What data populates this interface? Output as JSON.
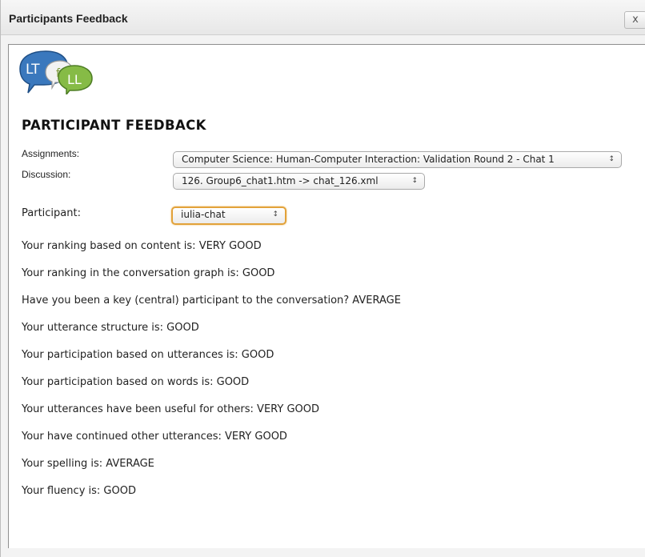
{
  "window": {
    "title": "Participants Feedback",
    "close_label": "x"
  },
  "logo": {
    "letters": [
      "LT",
      "f",
      "LL"
    ],
    "colors": [
      "#2f6fb1",
      "#8fbf4a",
      "#6fa84c"
    ]
  },
  "page": {
    "heading": "PARTICIPANT FEEDBACK"
  },
  "form": {
    "assignments_label": "Assignments:",
    "assignments_value": "Computer Science: Human-Computer Interaction: Validation Round 2 - Chat 1",
    "discussion_label": "Discussion:",
    "discussion_value": "126. Group6_chat1.htm -> chat_126.xml",
    "participant_label": "Participant:",
    "participant_value": "iulia-chat",
    "select_arrow": "↕"
  },
  "feedback": [
    "Your ranking based on content is: VERY GOOD",
    "Your ranking in the conversation graph is: GOOD",
    "Have you been a key (central) participant to the conversation? AVERAGE",
    "Your utterance structure is: GOOD",
    "Your participation based on utterances is: GOOD",
    "Your participation based on words is: GOOD",
    "Your utterances have been useful for others: VERY GOOD",
    "Your have continued other utterances: VERY GOOD",
    "Your spelling is: AVERAGE",
    "Your fluency is: GOOD"
  ]
}
